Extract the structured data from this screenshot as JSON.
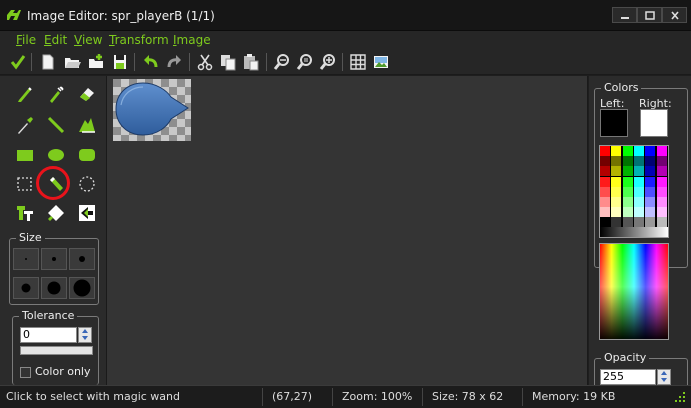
{
  "window": {
    "title": "Image Editor: spr_playerB (1/1)"
  },
  "menu": {
    "items": [
      {
        "hotkey": "F",
        "rest": "ile"
      },
      {
        "hotkey": "E",
        "rest": "dit"
      },
      {
        "hotkey": "V",
        "rest": "iew"
      },
      {
        "hotkey": "T",
        "rest": "ransform"
      },
      {
        "hotkey": "I",
        "rest": "mage"
      }
    ]
  },
  "toolbar": {
    "icons": [
      "confirm-check-icon",
      "new-file-icon",
      "open-file-icon",
      "add-file-icon",
      "save-icon",
      "undo-icon",
      "redo-icon",
      "cut-icon",
      "copy-icon",
      "paste-icon",
      "zoom-out-icon",
      "zoom-reset-icon",
      "zoom-in-icon",
      "grid-icon",
      "preview-image-icon"
    ]
  },
  "tools": {
    "selected": "magic-wand-tool",
    "rows": [
      [
        "pencil-tool",
        "spray-tool",
        "eraser-tool"
      ],
      [
        "color-picker-tool",
        "line-tool",
        "curve-tool"
      ],
      [
        "rectangle-tool",
        "ellipse-tool",
        "rounded-rectangle-tool"
      ],
      [
        "rectangle-select-tool",
        "magic-wand-tool",
        "ellipse-select-tool"
      ],
      [
        "text-tool",
        "fill-tool",
        "color-replace-tool"
      ]
    ]
  },
  "size_group": {
    "label": "Size",
    "selected_index": 0
  },
  "tolerance_group": {
    "label": "Tolerance",
    "value": "0",
    "color_only_label": "Color only",
    "color_only_checked": false
  },
  "colors_panel": {
    "label": "Colors",
    "left_label": "Left:",
    "right_label": "Right:",
    "left_color": "#000000",
    "right_color": "#ffffff"
  },
  "opacity_group": {
    "label": "Opacity",
    "value": "255"
  },
  "status": {
    "hint": "Click to select with magic wand",
    "cursor": "(67,27)",
    "zoom": "Zoom: 100%",
    "size": "Size: 78 x 62",
    "memory": "Memory: 19 KB"
  },
  "colors": {
    "accent": "#7ecb1d",
    "highlight_ring": "#e8131b",
    "sprite_fill": "#3d6fb0"
  }
}
